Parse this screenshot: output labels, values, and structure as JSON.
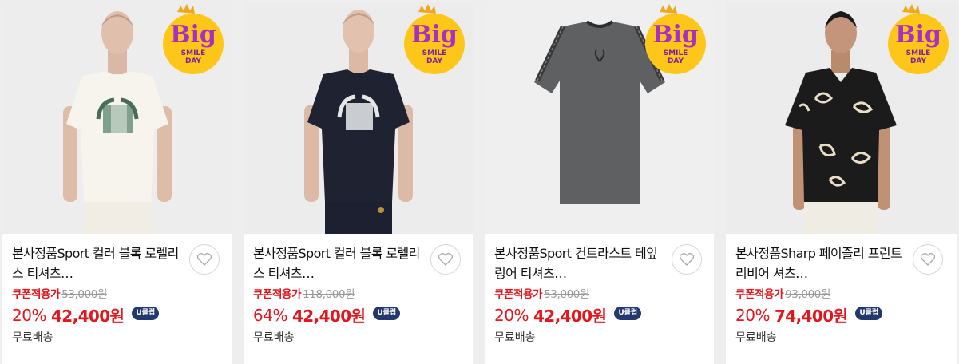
{
  "badge": {
    "line1": "Big",
    "line2": "SMILE",
    "line3": "DAY"
  },
  "products": [
    {
      "title": "본사정품Sport 컬러 블록 로렐리스 티셔츠…",
      "coupon_label": "쿠폰적용가",
      "original_price": "53,000원",
      "discount_rate": "20%",
      "sale_price": "42,400원",
      "uclub": "U클럽",
      "shipping": "무료배송"
    },
    {
      "title": "본사정품Sport 컬러 블록 로렐리스 티셔츠…",
      "coupon_label": "쿠폰적용가",
      "original_price": "118,000원",
      "discount_rate": "64%",
      "sale_price": "42,400원",
      "uclub": "U클럽",
      "shipping": "무료배송"
    },
    {
      "title": "본사정품Sport 컨트라스트 테잎 링어 티셔츠…",
      "coupon_label": "쿠폰적용가",
      "original_price": "53,000원",
      "discount_rate": "20%",
      "sale_price": "42,400원",
      "uclub": "U클럽",
      "shipping": "무료배송"
    },
    {
      "title": "본사정품Sharp 페이즐리 프린트 리비어 셔츠…",
      "coupon_label": "쿠폰적용가",
      "original_price": "93,000원",
      "discount_rate": "20%",
      "sale_price": "74,400원",
      "uclub": "U클럽",
      "shipping": "무료배송"
    }
  ],
  "colors": {
    "sale_red": "#e2161c",
    "uclub_navy": "#23386e",
    "badge_yellow": "#ffc61a",
    "badge_purple": "#a72fc4"
  }
}
